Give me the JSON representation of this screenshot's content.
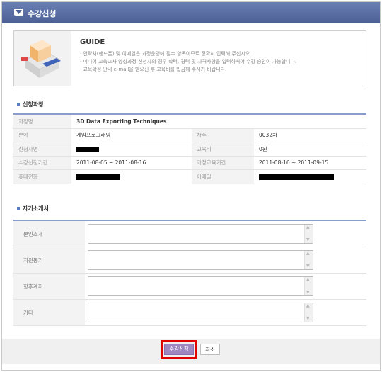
{
  "window": {
    "title": "수강신청"
  },
  "guide": {
    "title": "GUIDE",
    "lines": [
      "· 연락처(핸드폰) 및 이메일은 과정운영에 필수 항목이므로 정확히 입력해 주십시오",
      "· 미디어 교육교사 양성과정 신청자의 경우 학력, 경력 및 자격사항을 입력하셔야 수강 승인이 가능합니다.",
      "· 교육확정 안내 e-mail을 받으신 후 교육비를 입금해 주시기 바랍니다."
    ]
  },
  "course_section": {
    "heading": "신청과정",
    "course_name_label": "과정명",
    "course_name": "3D Data Exporting Techniques",
    "field_label": "분야",
    "field_value": "게임프로그래밍",
    "round_label": "차수",
    "round_value": "0032차",
    "applicant_label": "신청자명",
    "fee_label": "교육비",
    "fee_value": "0원",
    "apply_period_label": "수강신청기간",
    "apply_period_value": "2011-08-05 ~ 2011-08-16",
    "course_period_label": "과정교육기간",
    "course_period_value": "2011-08-16 ~ 2011-09-15",
    "phone_label": "휴대전화",
    "email_label": "이메일"
  },
  "intro_section": {
    "heading": "자기소개서",
    "fields": [
      "본인소개",
      "지원동기",
      "향후계획",
      "기타"
    ]
  },
  "buttons": {
    "apply": "수강신청",
    "cancel": "취소"
  },
  "colors": {
    "title_bar": "#5a6fa6",
    "table_top_border": "#8a9ccb",
    "apply_button": "#9f86c0",
    "highlight": "#e00000"
  }
}
